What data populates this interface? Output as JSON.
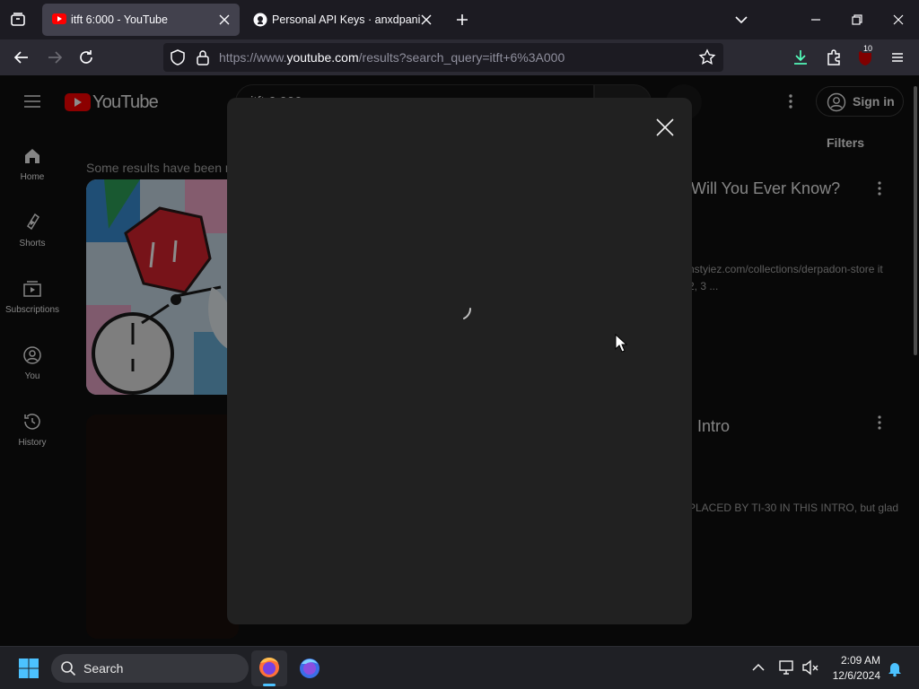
{
  "browser": {
    "tabs": [
      {
        "title": "itft 6:000 - YouTube",
        "active": true
      },
      {
        "title": "Personal API Keys · anxdpanic/",
        "active": false
      }
    ],
    "url_prefix": "https://www.",
    "url_domain": "youtube.com",
    "url_rest": "/results?search_query=itft+6%3A000",
    "extension_badge": "10"
  },
  "youtube": {
    "logo_text": "YouTube",
    "search_value": "itft 6:000",
    "sign_in_label": "Sign in",
    "filters_label": "Filters",
    "notice": "Some results have been r",
    "sidebar": [
      {
        "label": "Home",
        "icon": "home-icon"
      },
      {
        "label": "Shorts",
        "icon": "shorts-icon"
      },
      {
        "label": "Subscriptions",
        "icon": "subscriptions-icon"
      },
      {
        "label": "You",
        "icon": "you-icon"
      },
      {
        "label": "History",
        "icon": "history-icon"
      }
    ],
    "results": [
      {
        "title": "Will You Ever Know?",
        "desc_line1": "nstyiez.com/collections/derpadon-store it",
        "desc_line2": "2, 3 ..."
      },
      {
        "title": "Intro",
        "desc_line1": "PLACED BY TI-30 IN THIS INTRO, but glad"
      }
    ]
  },
  "taskbar": {
    "search_label": "Search",
    "time": "2:09 AM",
    "date": "12/6/2024"
  },
  "colors": {
    "yt_red": "#ff0000",
    "firefox_download": "#54ffbd",
    "sign_in_border": "#3f3f3f"
  }
}
